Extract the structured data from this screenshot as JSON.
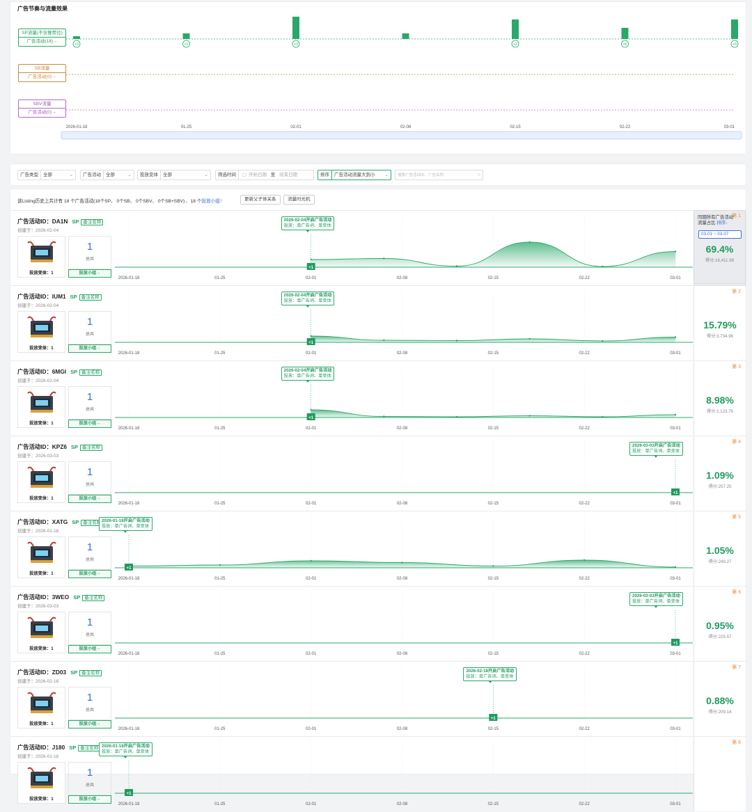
{
  "rhythm": {
    "title": "广告节奏与流量效果",
    "rows": [
      {
        "flow": "SP流量(不含推荐位)",
        "activity": "广告活动(18)→"
      },
      {
        "flow": "SB流量",
        "activity": "广告活动(0)→"
      },
      {
        "flow": "SBV流量",
        "activity": "广告活动(0)→"
      }
    ],
    "dates": [
      "2026-01-18",
      "01-25",
      "02-01",
      "02-08",
      "02-15",
      "02-22",
      "03-01"
    ],
    "bars": [
      {
        "date": "2026-01-18",
        "height": 1,
        "badge": "+3"
      },
      {
        "date": "01-25",
        "height": 2,
        "badge": "+1"
      },
      {
        "date": "02-01",
        "height": 8,
        "badge": "+3"
      },
      {
        "date": "02-08",
        "height": 2,
        "badge": ""
      },
      {
        "date": "02-15",
        "height": 7,
        "badge": "+2"
      },
      {
        "date": "02-22",
        "height": 4,
        "badge": "+6"
      },
      {
        "date": "03-01",
        "height": 7,
        "badge": "+3"
      }
    ],
    "colors": {
      "sp": "#2aa86a",
      "sb": "#c98a3e",
      "sbv": "#b06ac9"
    }
  },
  "filters": {
    "type": {
      "label": "广告类型",
      "value": "全部"
    },
    "activity": {
      "label": "广告活动",
      "value": "全部"
    },
    "variant": {
      "label": "投放变体",
      "value": "全部"
    },
    "time": {
      "label": "筛选时间",
      "start": "开始日期",
      "sep": "至",
      "end": "结束日期"
    },
    "sort": {
      "label": "排序",
      "value": "广告活动流量大到小"
    },
    "search_placeholder": "搜索广告活动ID、广告名称"
  },
  "summary": {
    "text_pre": "该Listing历史上共计有 18 个广告活动(18个SP、 0个SB、 0个SBV、 0个SB+SBV) 、18 个",
    "link": "投放小组",
    "help": "?",
    "btn_parent": "更新父子体关系",
    "btn_machine": "流量时光机"
  },
  "rank_header": {
    "title_line1": "同期所有广告活动",
    "title_line2": "流量占比",
    "sort_label": "排序↓",
    "date_range": "03-01 ~ 03-07"
  },
  "campaign_labels": {
    "id_prefix": "广告活动ID：",
    "type_sp": "SP",
    "note_tag": "备注名称",
    "created_prefix": "创建于：",
    "variant_label": "投放变体：",
    "total": "总共",
    "group_btn": "投放小组→",
    "callout_suffix": "开启广告活动",
    "callout_line2": "投放：单广告词、单变体",
    "score_prefix": "得分:"
  },
  "campaigns": [
    {
      "id": "DA1N",
      "created": "2026-02-04",
      "variants": "1",
      "count": "1",
      "callout_date": "2026-02-04",
      "start": "02-01",
      "badge": "+1",
      "rank": "第 1",
      "pct": "69.4%",
      "score": "16,411.98",
      "curve": [
        0.22,
        0.25,
        0.03,
        0.72,
        0.02,
        0.45
      ]
    },
    {
      "id": "IUM1",
      "created": "2026-02-04",
      "variants": "1",
      "count": "1",
      "callout_date": "2026-02-04",
      "start": "02-01",
      "badge": "+1",
      "rank": "第 2",
      "pct": "15.79%",
      "score": "3,734.96",
      "curve": [
        0.18,
        0.06,
        0.05,
        0.1,
        0.04,
        0.15
      ]
    },
    {
      "id": "6MGI",
      "created": "2026-02-04",
      "variants": "1",
      "count": "1",
      "callout_date": "2026-02-04",
      "start": "02-01",
      "badge": "+1",
      "rank": "第 3",
      "pct": "8.98%",
      "score": "2,123.76",
      "curve": [
        0.22,
        0.03,
        0.02,
        0.05,
        0.02,
        0.08
      ]
    },
    {
      "id": "KPZ6",
      "created": "2026-03-03",
      "variants": "1",
      "count": "1",
      "callout_date": "2026-03-03",
      "start": "03-01",
      "badge": "+1",
      "rank": "第 4",
      "pct": "1.09%",
      "score": "257.25",
      "curve": []
    },
    {
      "id": "XATG",
      "created": "2026-01-18",
      "variants": "1",
      "count": "1",
      "callout_date": "2026-01-18",
      "start": "2026-01-18",
      "badge": "+1",
      "rank": "第 5",
      "pct": "1.05%",
      "score": "249.27",
      "curve": [
        0.05,
        0.08,
        0.2,
        0.15,
        0.05,
        0.22,
        0.02
      ]
    },
    {
      "id": "3WEO",
      "created": "2026-03-03",
      "variants": "1",
      "count": "1",
      "callout_date": "2026-03-03",
      "start": "03-01",
      "badge": "+1",
      "rank": "第 6",
      "pct": "0.95%",
      "score": "225.57",
      "curve": []
    },
    {
      "id": "ZD03",
      "created": "2026-02-18",
      "variants": "1",
      "count": "1",
      "callout_date": "2026-02-18",
      "start": "02-15",
      "badge": "+1",
      "rank": "第 7",
      "pct": "0.88%",
      "score": "209.14",
      "curve": []
    },
    {
      "id": "J180",
      "created": "2026-01-18",
      "variants": "1",
      "count": "1",
      "callout_date": "2026-01-18",
      "start": "2026-01-18",
      "badge": "+1",
      "rank": "第 8",
      "pct": "",
      "score": "",
      "curve": []
    }
  ]
}
